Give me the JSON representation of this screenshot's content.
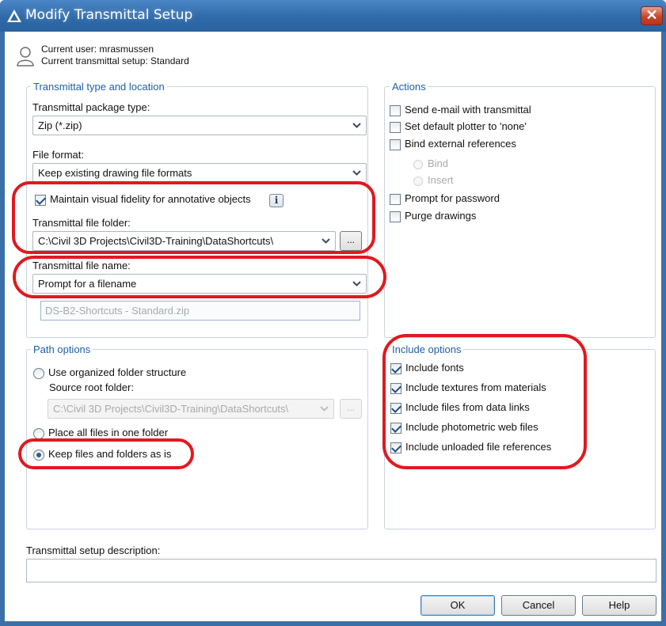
{
  "window": {
    "title": "Modify Transmittal Setup",
    "close_glyph": "✕"
  },
  "user": {
    "current_user": "Current user: mrasmussen",
    "current_setup": "Current transmittal setup: Standard"
  },
  "type_location": {
    "legend": "Transmittal type and location",
    "package_type_label": "Transmittal package type:",
    "package_type_value": "Zip (*.zip)",
    "file_format_label": "File format:",
    "file_format_value": "Keep existing drawing file formats",
    "maintain_fidelity_label": "Maintain visual fidelity for annotative objects",
    "maintain_fidelity_checked": true,
    "info_glyph": "i",
    "folder_label": "Transmittal file folder:",
    "folder_value": "C:\\Civil 3D Projects\\Civil3D-Training\\DataShortcuts\\",
    "browse_label": "...",
    "file_name_label": "Transmittal file name:",
    "file_name_value": "Prompt for a filename",
    "file_name_preview": "DS-B2-Shortcuts - Standard.zip"
  },
  "actions": {
    "legend": "Actions",
    "send_email": "Send e-mail with transmittal",
    "set_plotter": "Set default plotter to 'none'",
    "bind_xrefs": "Bind external references",
    "bind": "Bind",
    "insert": "Insert",
    "prompt_password": "Prompt for password",
    "purge": "Purge drawings"
  },
  "path_options": {
    "legend": "Path options",
    "organized": "Use organized folder structure",
    "source_root_label": "Source root folder:",
    "source_root_value": "C:\\Civil 3D Projects\\Civil3D-Training\\DataShortcuts\\",
    "browse_label": "...",
    "one_folder": "Place all files in one folder",
    "keep_as_is": "Keep files and folders as is"
  },
  "include_options": {
    "legend": "Include options",
    "items": [
      {
        "label": "Include fonts",
        "checked": true
      },
      {
        "label": "Include textures from materials",
        "checked": true
      },
      {
        "label": "Include files from data links",
        "checked": true
      },
      {
        "label": "Include photometric web files",
        "checked": true
      },
      {
        "label": "Include unloaded file references",
        "checked": true
      }
    ]
  },
  "description": {
    "label": "Transmittal setup description:",
    "value": ""
  },
  "buttons": {
    "ok": "OK",
    "cancel": "Cancel",
    "help": "Help"
  },
  "colors": {
    "titlebar": "#2f6aa8",
    "legend_text": "#1f5fa8",
    "annotation_oval": "#e0191f"
  }
}
